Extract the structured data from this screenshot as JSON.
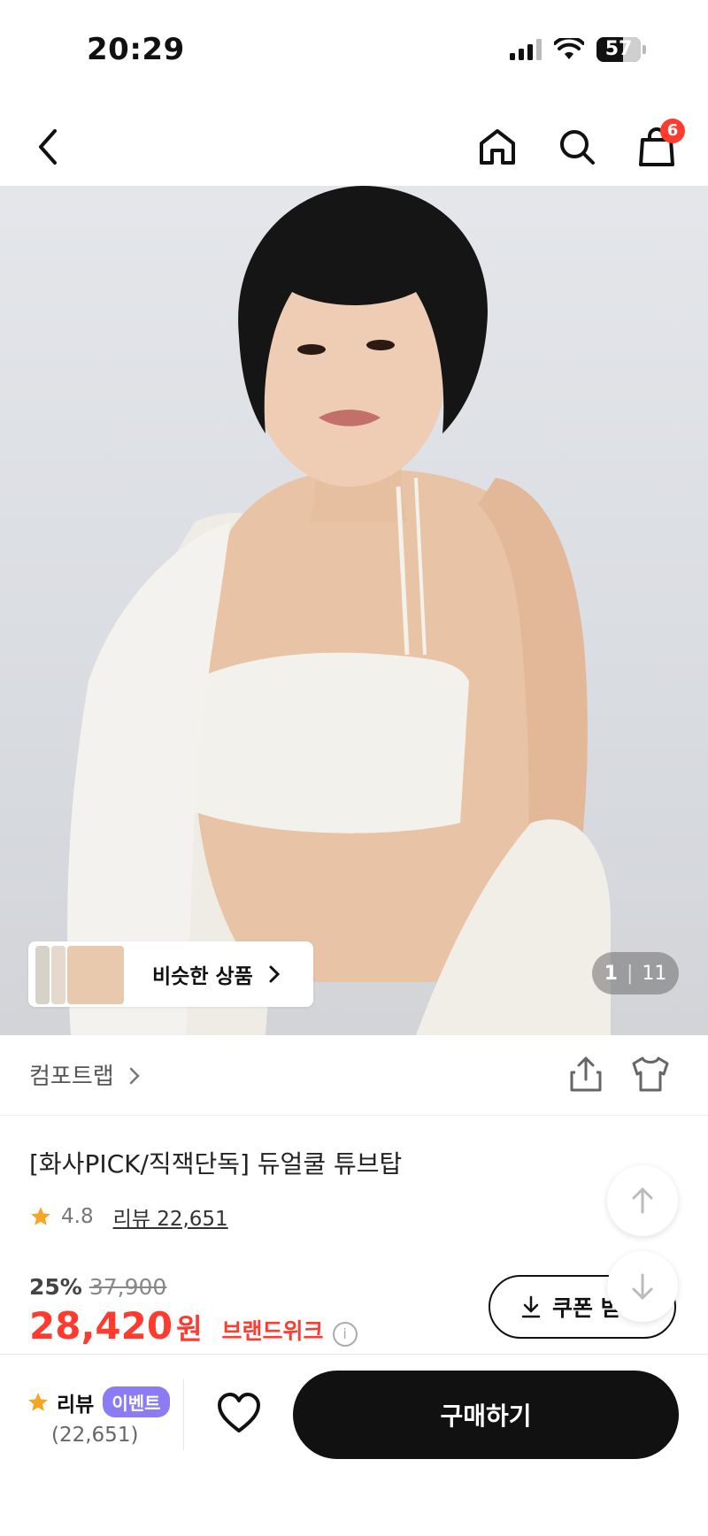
{
  "status_bar": {
    "time": "20:29",
    "battery": "57"
  },
  "nav": {
    "cart_count": "6"
  },
  "hero": {
    "similar_label": "비슷한 상품",
    "pager_current": "1",
    "pager_total": "11"
  },
  "product": {
    "brand": "컴포트랩",
    "title": "[화사PICK/직잭단독] 듀얼쿨 튜브탑",
    "rating": "4.8",
    "review_link": "리뷰 22,651",
    "discount": "25%",
    "original_price": "37,900",
    "price": "28,420",
    "currency": "원",
    "brand_week": "브랜드위크",
    "coupon_label": "쿠폰 받"
  },
  "bottom_bar": {
    "review_label": "리뷰",
    "event_label": "이벤트",
    "review_count": "(22,651)",
    "buy_label": "구매하기"
  },
  "colors": {
    "accent_red": "#ff3b30",
    "star": "#f5a623",
    "event_purple": "#8b7cf6",
    "button_black": "#111111"
  }
}
